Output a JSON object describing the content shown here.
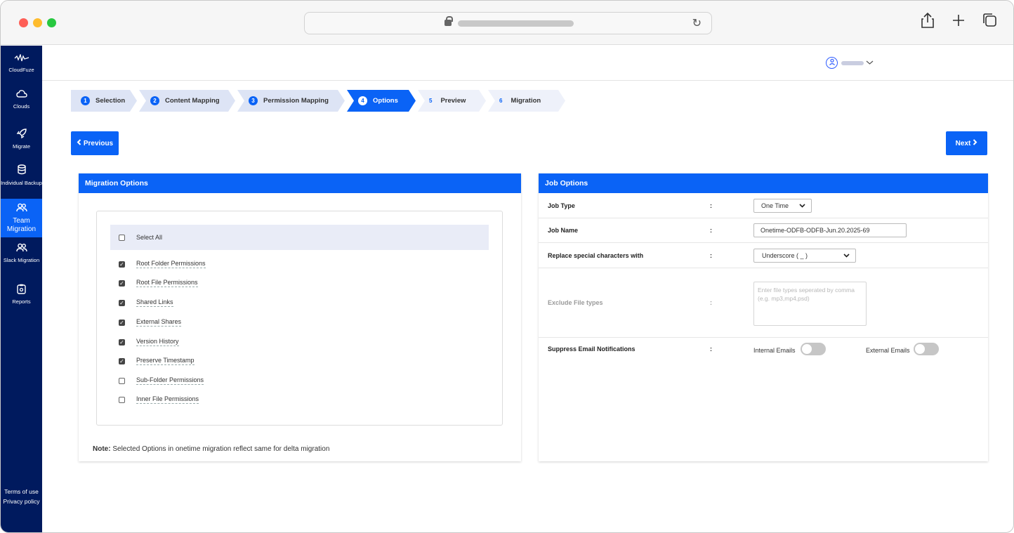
{
  "browser": {
    "reload_icon": "reload-icon",
    "share_icon": "share-icon",
    "new_tab_icon": "plus-icon",
    "tabs_icon": "tabs-icon"
  },
  "sidebar": {
    "logo": "CloudFuze",
    "items": [
      {
        "label": "Clouds",
        "icon": "cloud-icon"
      },
      {
        "label": "Migrate",
        "icon": "rocket-icon"
      },
      {
        "label": "Individual Backup",
        "icon": "database-icon"
      },
      {
        "label": "Team Migration",
        "icon": "users-icon"
      },
      {
        "label": "Slack Migration",
        "icon": "users-icon"
      },
      {
        "label": "Reports",
        "icon": "clipboard-icon"
      }
    ],
    "terms": "Terms of use",
    "privacy": "Privacy policy"
  },
  "steps": [
    {
      "num": "1",
      "label": "Selection"
    },
    {
      "num": "2",
      "label": "Content Mapping"
    },
    {
      "num": "3",
      "label": "Permission Mapping"
    },
    {
      "num": "4",
      "label": "Options"
    },
    {
      "num": "5",
      "label": "Preview"
    },
    {
      "num": "6",
      "label": "Migration"
    }
  ],
  "nav": {
    "previous": "Previous",
    "next": "Next"
  },
  "migration_options": {
    "title": "Migration Options",
    "select_all": "Select All",
    "options": [
      {
        "label": "Root Folder Permissions",
        "checked": true
      },
      {
        "label": "Root File Permissions",
        "checked": true
      },
      {
        "label": "Shared Links",
        "checked": true
      },
      {
        "label": "External Shares",
        "checked": true
      },
      {
        "label": "Version History",
        "checked": true
      },
      {
        "label": "Preserve Timestamp",
        "checked": true
      },
      {
        "label": "Sub-Folder Permissions",
        "checked": false
      },
      {
        "label": "Inner File Permissions",
        "checked": false
      }
    ],
    "note_label": "Note:",
    "note_text": " Selected Options in onetime migration reflect same for delta migration"
  },
  "job_options": {
    "title": "Job Options",
    "colon": ":",
    "job_type_label": "Job Type",
    "job_type_value": "One Time",
    "job_name_label": "Job Name",
    "job_name_value": "Onetime-ODFB-ODFB-Jun.20.2025-69",
    "replace_label": "Replace special characters with",
    "replace_value": "Underscore ( _ )",
    "exclude_label": "Exclude File types",
    "exclude_placeholder": "Enter file types seperated by comma (e.g. mp3,mp4,psd)",
    "suppress_label": "Suppress Email Notifications",
    "internal_label": "Internal Emails",
    "external_label": "External Emails",
    "internal_on": false,
    "external_on": false
  }
}
